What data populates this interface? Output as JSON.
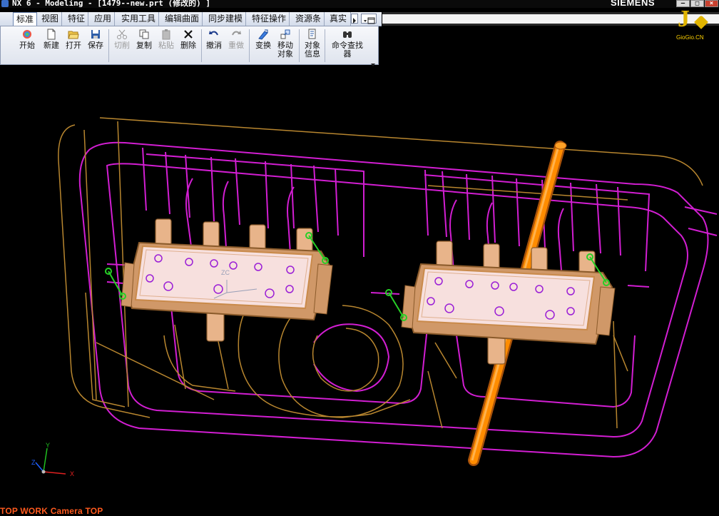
{
  "window": {
    "title": "NX 6 - Modeling - [1479--new.prt  (修改的) ]",
    "brand": "SIEMENS",
    "controls": [
      "–",
      "□",
      "×"
    ]
  },
  "menu": {
    "tabs": [
      "标准",
      "视图",
      "特征",
      "应用",
      "实用工具",
      "编辑曲面",
      "同步建模",
      "特征操作",
      "资源条",
      "真实"
    ],
    "active_tab": "标准"
  },
  "toolbar": {
    "buttons": [
      {
        "label": "开始",
        "icon": "start-icon"
      },
      {
        "label": "新建",
        "icon": "new-file-icon"
      },
      {
        "label": "打开",
        "icon": "open-folder-icon"
      },
      {
        "label": "保存",
        "icon": "save-icon"
      },
      {
        "label": "切削",
        "icon": "cut-icon"
      },
      {
        "label": "复制",
        "icon": "copy-icon"
      },
      {
        "label": "粘贴",
        "icon": "paste-icon"
      },
      {
        "label": "删除",
        "icon": "delete-icon"
      },
      {
        "label": "撤消",
        "icon": "undo-icon"
      },
      {
        "label": "重做",
        "icon": "redo-icon"
      },
      {
        "label": "变换",
        "icon": "transform-icon"
      },
      {
        "label": "移动对象",
        "icon": "move-object-icon"
      },
      {
        "label": "对象信息",
        "icon": "object-info-icon"
      },
      {
        "label": "命令查找器",
        "icon": "command-finder-icon"
      }
    ]
  },
  "viewport": {
    "status_text": "TOP WORK Camera TOP",
    "triad": {
      "x": "X",
      "y": "Y",
      "z": "Z"
    },
    "wcs_label": "ZC",
    "colors": {
      "background": "#000000",
      "mold_base": "#d21ed2",
      "insert_wire": "#b8862f",
      "manifold": "#f5dcdc",
      "manifold_edge": "#c98a4a",
      "cooling_pipe": "#ff8c00",
      "hole": "#9b1fd6",
      "green_markers": "#27d027"
    }
  },
  "watermark": {
    "logo_text": "GioGio.CN",
    "glyph": "J"
  }
}
